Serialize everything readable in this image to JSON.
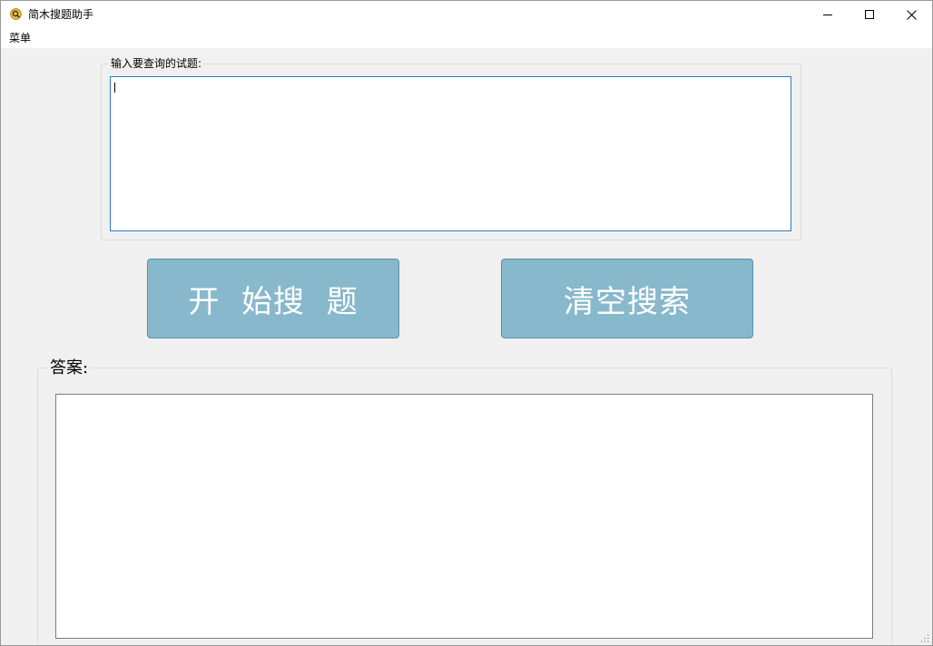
{
  "window": {
    "title": "简木搜题助手",
    "controls": [
      "minimize-icon",
      "maximize-icon",
      "close-icon"
    ]
  },
  "menu": {
    "items": [
      {
        "label": "菜单"
      }
    ]
  },
  "question": {
    "group_label": "输入要查询的试题:",
    "value": ""
  },
  "buttons": {
    "search_label": "开  始搜  题",
    "clear_label": "清空搜索"
  },
  "answer": {
    "group_label": "答案:",
    "value": ""
  },
  "colors": {
    "button_fill": "#88b8cb",
    "button_border": "#5b8fae",
    "input_focus_border": "#2f7bbf"
  }
}
